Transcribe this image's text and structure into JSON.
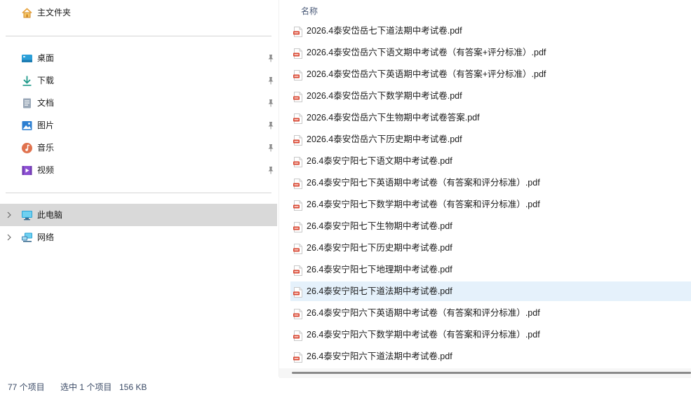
{
  "nav": {
    "home": {
      "label": "主文件夹",
      "icon": "home-icon"
    },
    "quick_access": [
      {
        "label": "桌面",
        "icon": "desktop-icon",
        "color": "#2b9fd8"
      },
      {
        "label": "下载",
        "icon": "download-icon",
        "color": "#1f9a8a"
      },
      {
        "label": "文档",
        "icon": "documents-icon",
        "color": "#7d8fa3"
      },
      {
        "label": "图片",
        "icon": "pictures-icon",
        "color": "#2d7fd1"
      },
      {
        "label": "音乐",
        "icon": "music-icon",
        "color": "#e0734f"
      },
      {
        "label": "视频",
        "icon": "videos-icon",
        "color": "#8b4fd1"
      }
    ],
    "pin_icon": "pin-icon",
    "this_pc": {
      "label": "此电脑",
      "icon": "this-pc-icon",
      "selected": true
    },
    "network": {
      "label": "网络",
      "icon": "network-icon"
    }
  },
  "files": {
    "column_header": "名称",
    "selected_index": 12,
    "items": [
      "2026.4泰安岱岳七下道法期中考试卷.pdf",
      "2026.4泰安岱岳六下语文期中考试卷（有答案+评分标准）.pdf",
      "2026.4泰安岱岳六下英语期中考试卷（有答案+评分标准）.pdf",
      "2026.4泰安岱岳六下数学期中考试卷.pdf",
      "2026.4泰安岱岳六下生物期中考试卷答案.pdf",
      "2026.4泰安岱岳六下历史期中考试卷.pdf",
      "26.4泰安宁阳七下语文期中考试卷.pdf",
      "26.4泰安宁阳七下英语期中考试卷（有答案和评分标准）.pdf",
      "26.4泰安宁阳七下数学期中考试卷（有答案和评分标准）.pdf",
      "26.4泰安宁阳七下生物期中考试卷.pdf",
      "26.4泰安宁阳七下历史期中考试卷.pdf",
      "26.4泰安宁阳七下地理期中考试卷.pdf",
      "26.4泰安宁阳七下道法期中考试卷.pdf",
      "26.4泰安宁阳六下英语期中考试卷（有答案和评分标准）.pdf",
      "26.4泰安宁阳六下数学期中考试卷（有答案和评分标准）.pdf",
      "26.4泰安宁阳六下道法期中考试卷.pdf"
    ],
    "file_icon": "pdf-file-icon"
  },
  "status": {
    "item_count": "77 个项目",
    "selection": "选中 1 个项目",
    "size": "156 KB"
  }
}
